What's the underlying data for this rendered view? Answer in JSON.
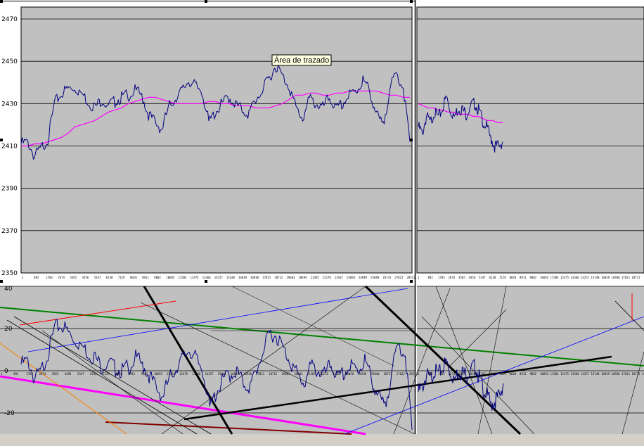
{
  "chart_data": [
    {
      "type": "line",
      "ylim": [
        2350,
        2470
      ],
      "y_ticks": [
        "2470",
        "2450",
        "2430",
        "2410",
        "2390",
        "2370",
        "2350"
      ],
      "x_ticks": [
        "1",
        "892",
        "1783",
        "2674",
        "3565",
        "4456",
        "5347",
        "6238",
        "7129",
        "8020",
        "8911",
        "9802",
        "10693",
        "11584",
        "12475",
        "13366",
        "14257",
        "15148",
        "16039",
        "16930",
        "17821",
        "18712",
        "19603",
        "20494",
        "21385",
        "22276",
        "23167",
        "24058",
        "24949",
        "25840",
        "26731",
        "27622",
        "28513"
      ],
      "series": [
        {
          "color": "#000080",
          "values": [
            2411,
            2412,
            2405,
            2409,
            2413,
            2430,
            2435,
            2437,
            2438,
            2435,
            2431,
            2428,
            2432,
            2429,
            2431,
            2433,
            2434,
            2436,
            2434,
            2425,
            2421,
            2418,
            2428,
            2433,
            2436,
            2441,
            2438,
            2436,
            2421,
            2426,
            2430,
            2433,
            2430,
            2427,
            2425,
            2432,
            2436,
            2442,
            2448,
            2443,
            2438,
            2428,
            2423,
            2432,
            2430,
            2428,
            2433,
            2427,
            2430,
            2434,
            2436,
            2441,
            2436,
            2425,
            2419,
            2437,
            2444,
            2438,
            2412
          ]
        },
        {
          "color": "#ff00ff",
          "values": [
            2410,
            2410,
            2411,
            2411,
            2412,
            2413,
            2414,
            2416,
            2419,
            2420,
            2421,
            2422,
            2424,
            2426,
            2427,
            2428,
            2430,
            2431,
            2432,
            2433,
            2433,
            2432,
            2431,
            2430,
            2430,
            2430,
            2430,
            2430,
            2431,
            2431,
            2430,
            2430,
            2429,
            2429,
            2429,
            2428,
            2428,
            2428,
            2429,
            2430,
            2432,
            2434,
            2434,
            2435,
            2435,
            2434,
            2434,
            2435,
            2435,
            2436,
            2436,
            2436,
            2436,
            2436,
            2435,
            2434,
            2434,
            2433,
            2433
          ]
        }
      ],
      "tooltip": "Área de trazado"
    },
    {
      "type": "line",
      "x_ticks": [
        "1",
        "892",
        "1783",
        "2674",
        "3565",
        "4456",
        "5347",
        "6238",
        "7129",
        "8020",
        "8911",
        "9802",
        "10693",
        "11584",
        "12475",
        "13366",
        "14257",
        "15148",
        "16039",
        "16930",
        "17821",
        "18712"
      ],
      "series": [
        {
          "color": "#000080",
          "values": [
            2419,
            2416,
            2424,
            2421,
            2426,
            2423,
            2428,
            2433,
            2427,
            2424,
            2428,
            2427,
            2425,
            2429,
            2430,
            2427,
            2422,
            2419,
            2414,
            2410,
            2410,
            2412
          ]
        },
        {
          "color": "#ff00ff",
          "values": [
            2430,
            2429,
            2428,
            2428,
            2427,
            2427,
            2426,
            2426,
            2425,
            2425,
            2425,
            2424,
            2424,
            2423,
            2422,
            2422,
            2421,
            2421
          ]
        }
      ]
    },
    {
      "type": "line",
      "ylim": [
        -30,
        40
      ],
      "y_ticks": [
        "40",
        "20",
        "0",
        "-20"
      ],
      "x_ticks": [
        "1",
        "892",
        "1783",
        "2674",
        "3565",
        "4456",
        "5347",
        "6238",
        "7129",
        "8020",
        "8911",
        "9802",
        "10693",
        "11584",
        "12475",
        "13366",
        "14257",
        "15148",
        "16039",
        "16930",
        "17821",
        "18712",
        "19603",
        "20494",
        "21385",
        "22276",
        "23167",
        "24058",
        "24949",
        "25840",
        "26731",
        "27622",
        "28513"
      ],
      "series": [
        {
          "color": "#000080",
          "values": [
            3,
            5,
            -4,
            0,
            8,
            20,
            22,
            18,
            15,
            12,
            8,
            6,
            2,
            4,
            1,
            0,
            2,
            6,
            3,
            -2,
            -8,
            -12,
            -4,
            2,
            6,
            10,
            5,
            0,
            -18,
            -10,
            -4,
            -2,
            0,
            -6,
            -8,
            1,
            10,
            18,
            16,
            10,
            4,
            -2,
            -6,
            2,
            0,
            -2,
            3,
            -4,
            -1,
            2,
            0,
            5,
            -4,
            -12,
            -18,
            0,
            12,
            8,
            -28
          ]
        }
      ]
    },
    {
      "type": "line",
      "x_ticks": [
        "1",
        "892",
        "1783",
        "2674",
        "3565",
        "4456",
        "5347",
        "6238",
        "7129",
        "8020",
        "8911",
        "9802",
        "10693",
        "11584",
        "12475",
        "13366",
        "14257",
        "15148",
        "16039",
        "16930",
        "17821",
        "18712",
        "19603"
      ],
      "series": [
        {
          "color": "#000080",
          "values": [
            -10,
            -8,
            -2,
            -4,
            0,
            -2,
            2,
            4,
            -1,
            -4,
            0,
            -1,
            -2,
            1,
            2,
            -3,
            -8,
            -12,
            -16,
            -14,
            -12,
            -6
          ]
        }
      ]
    }
  ]
}
